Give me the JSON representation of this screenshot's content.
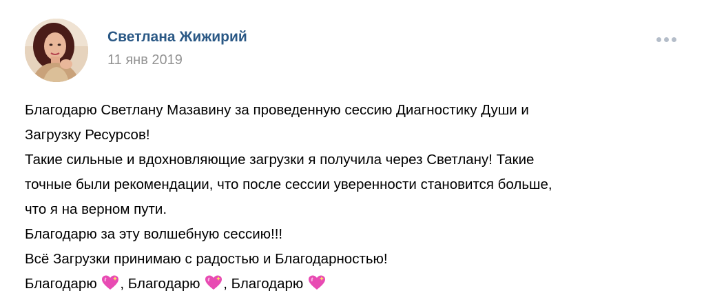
{
  "post": {
    "author": "Светлана Жижирий",
    "date": "11 янв 2019",
    "lines": [
      "Благодарю Светлану Мазавину за проведенную сессию Диагностику Души и",
      "Загрузку Ресурсов!",
      "Такие сильные и вдохновляющие загрузки я получила через Светлану! Такие",
      "точные были рекомендации, что после сессии уверенности становится больше,",
      "что я на верном пути.",
      "Благодарю за эту волшебную сессию!!!",
      "Всё Загрузки принимаю с радостью и Благодарностью!"
    ],
    "last_line": {
      "word1": "Благодарю",
      "sep1": ", Благодарю",
      "sep2": ", Благодарю"
    },
    "icons": {
      "more": "ellipsis-icon",
      "heart": "sparkling-heart-icon"
    },
    "colors": {
      "author": "#2a5885",
      "date": "#939393",
      "heart": "#e84bb3"
    }
  }
}
